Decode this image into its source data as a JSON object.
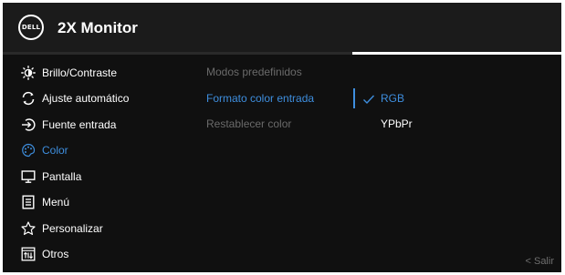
{
  "header": {
    "logo_text": "DELL",
    "title": "2X Monitor"
  },
  "menu": {
    "items": [
      {
        "label": "Brillo/Contraste",
        "icon": "brightness-icon"
      },
      {
        "label": "Ajuste automático",
        "icon": "auto-adjust-icon"
      },
      {
        "label": "Fuente entrada",
        "icon": "input-source-icon"
      },
      {
        "label": "Color",
        "icon": "palette-icon",
        "active": true
      },
      {
        "label": "Pantalla",
        "icon": "display-icon"
      },
      {
        "label": "Menú",
        "icon": "menu-icon"
      },
      {
        "label": "Personalizar",
        "icon": "star-icon"
      },
      {
        "label": "Otros",
        "icon": "others-icon"
      }
    ]
  },
  "submenu": {
    "items": [
      {
        "label": "Modos predefinidos"
      },
      {
        "label": "Formato color entrada",
        "active": true
      },
      {
        "label": "Restablecer color"
      }
    ]
  },
  "options": {
    "items": [
      {
        "label": "RGB",
        "selected": true
      },
      {
        "label": "YPbPr"
      }
    ]
  },
  "footer": {
    "exit_label": "< Salir"
  },
  "colors": {
    "accent": "#3e8ede",
    "background": "#101010",
    "header": "#1b1b1b"
  }
}
